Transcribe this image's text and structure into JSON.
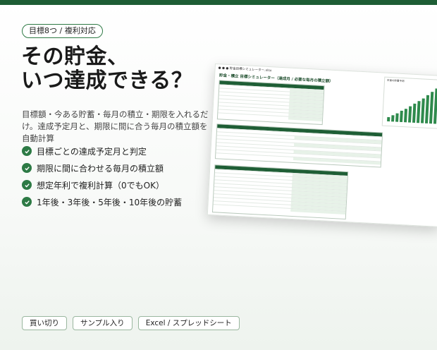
{
  "pill": {
    "label": "目標8つ / 複利対応"
  },
  "headline": {
    "line1": "その貯金、",
    "line2": "いつ達成できる？"
  },
  "desc": "目標額・今ある貯蓄・毎月の積立・期限を入れるだけ。達成予定月と、期限に間に合う毎月の積立額を自動計算",
  "features": [
    "目標ごとの達成予定月と判定",
    "期限に間に合わせる毎月の積立額",
    "想定年利で複利計算（0でもOK）",
    "1年後・3年後・5年後・10年後の貯蓄"
  ],
  "badges": [
    "買い切り",
    "サンプル入り",
    "Excel / スプレッドシート"
  ],
  "sheet": {
    "title": "● ● ●  貯金目標シミュレーター.xlsx",
    "heading": "貯金・積立 目標シミュレーター（達成月 / 必要な毎月の積立額）",
    "chart_title": "年後の貯蓄予測",
    "chart_bars": [
      10,
      16,
      22,
      28,
      34,
      40,
      47,
      54,
      62,
      70,
      79,
      88
    ]
  },
  "colors": {
    "brand": "#1e5e35",
    "accent": "#2d7a45"
  }
}
